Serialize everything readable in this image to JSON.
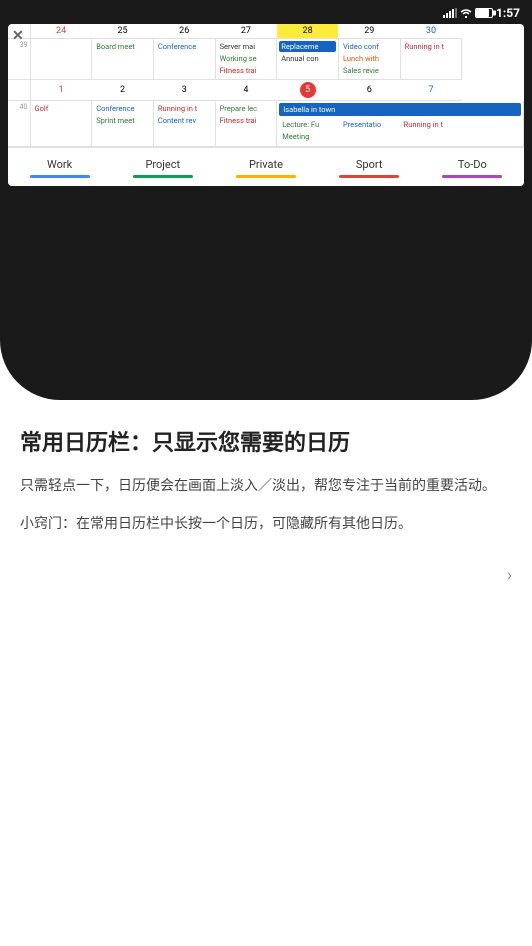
{
  "status_bar": {
    "time": "1:57",
    "signal": "▲▼",
    "battery": "80"
  },
  "calendar": {
    "close_label": "✕",
    "week1": {
      "num": "39",
      "days": [
        {
          "date": "24",
          "type": "sunday",
          "events": []
        },
        {
          "date": "25",
          "type": "normal",
          "events": [
            "Board meet"
          ]
        },
        {
          "date": "26",
          "type": "normal",
          "events": [
            "Conference"
          ]
        },
        {
          "date": "27",
          "type": "normal",
          "events": [
            "Server mai",
            "Working se",
            "Fitness trai"
          ]
        },
        {
          "date": "28",
          "type": "normal",
          "events_highlight": [
            "Replaceme"
          ],
          "events": [
            "Annual con"
          ]
        },
        {
          "date": "29",
          "type": "normal",
          "events": [
            "Video conf",
            "Lunch with",
            "Sales revie"
          ]
        },
        {
          "date": "30",
          "type": "saturday",
          "events": [
            "Running in t"
          ]
        }
      ]
    },
    "week2": {
      "num": "40",
      "days": [
        {
          "date": "1",
          "type": "sunday",
          "events": [
            "Golf"
          ]
        },
        {
          "date": "2",
          "type": "normal",
          "events": [
            "Conference",
            "Sprint meet"
          ]
        },
        {
          "date": "3",
          "type": "normal",
          "events": [
            "Running in t",
            "Content rev"
          ]
        },
        {
          "date": "4",
          "type": "normal",
          "events": [
            "Prepare lec",
            "Fitness trai"
          ]
        },
        {
          "date": "5",
          "type": "today",
          "events": [
            "Lecture: Fu",
            "Meeting"
          ]
        },
        {
          "date": "6",
          "type": "normal",
          "events": [
            "Presentatio"
          ]
        },
        {
          "date": "7",
          "type": "saturday",
          "events": [
            "Running in t"
          ]
        }
      ],
      "spanning_event": "Isabella in town"
    },
    "bar_items": [
      {
        "label": "Work",
        "color": "#4285f4"
      },
      {
        "label": "Project",
        "color": "#0f9d58"
      },
      {
        "label": "Private",
        "color": "#f4b400"
      },
      {
        "label": "Sport",
        "color": "#db4437"
      },
      {
        "label": "To-Do",
        "color": "#ab47bc"
      }
    ]
  },
  "content": {
    "title": "常用日历栏：只显示您需要的日历",
    "body1": "只需轻点一下，日历便会在画面上淡入／淡出，帮您专注于当前的重要活动。",
    "tip": "小窍门：在常用日历栏中长按一个日历，可隐藏所有其他日历。"
  },
  "bottom_arrow": "›"
}
